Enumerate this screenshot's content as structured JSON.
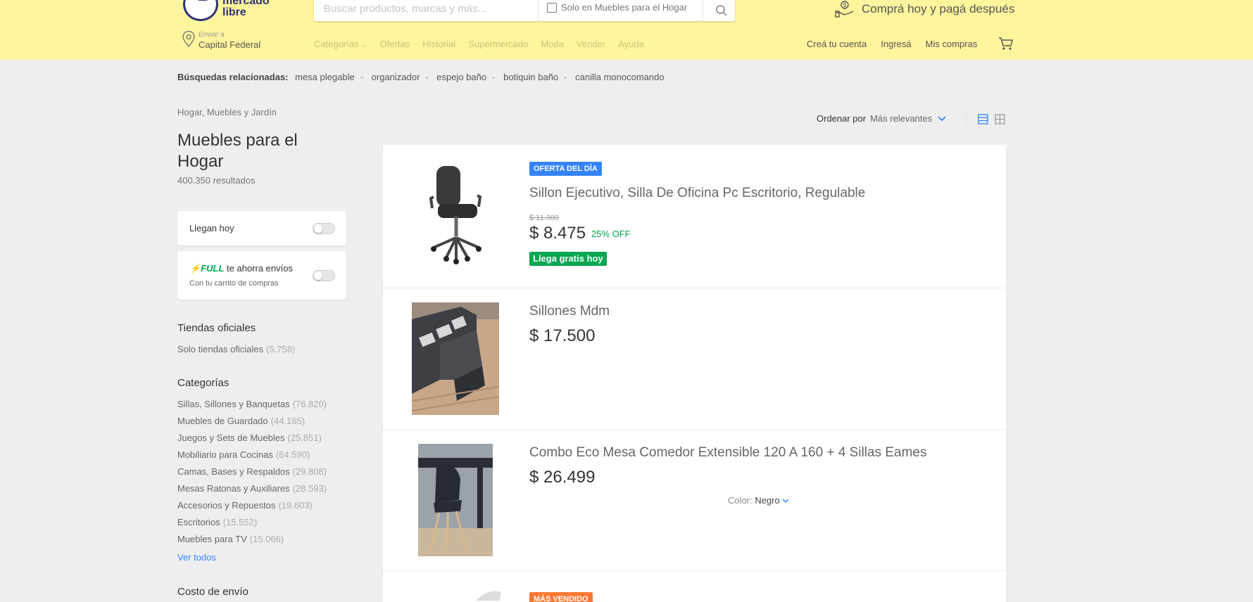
{
  "header": {
    "logo_text_line1": "mercado",
    "logo_text_line2": "libre",
    "search_placeholder": "Buscar productos, marcas y más...",
    "search_filter_label": "Solo en Muebles para el Hogar",
    "promo_text": "Comprá hoy y pagá después",
    "location_small": "Enviar a",
    "location_big": "Capital Federal",
    "nav": [
      "Categorías",
      "Ofertas",
      "Historial",
      "Supermercado",
      "Moda",
      "Vender",
      "Ayuda"
    ],
    "user_nav": [
      "Creá tu cuenta",
      "Ingresá",
      "Mis compras"
    ]
  },
  "related": {
    "label": "Búsquedas relacionadas:",
    "items": [
      "mesa plegable",
      "organizador",
      "espejo baño",
      "botiquin baño",
      "canilla monocomando"
    ]
  },
  "sidebar": {
    "breadcrumb": "Hogar, Muebles y Jardín",
    "title": "Muebles para el Hogar",
    "results": "400.350 resultados",
    "filter_today": "Llegan hoy",
    "full_badge": "FULL",
    "full_label": "te ahorra envíos",
    "full_sub": "Con tu carrito de compras",
    "official_title": "Tiendas oficiales",
    "official_link": "Solo tiendas oficiales",
    "official_count": "(5.758)",
    "categories_title": "Categorías",
    "categories": [
      {
        "label": "Sillas, Sillones y Banquetas",
        "count": "(76.820)"
      },
      {
        "label": "Muebles de Guardado",
        "count": "(44.165)"
      },
      {
        "label": "Juegos y Sets de Muebles",
        "count": "(25.851)"
      },
      {
        "label": "Mobiliario para Cocinas",
        "count": "(64.590)"
      },
      {
        "label": "Camas, Bases y Respaldos",
        "count": "(29.808)"
      },
      {
        "label": "Mesas Ratonas y Auxiliares",
        "count": "(28.593)"
      },
      {
        "label": "Accesorios y Repuestos",
        "count": "(19.603)"
      },
      {
        "label": "Escritorios",
        "count": "(15.552)"
      },
      {
        "label": "Muebles para TV",
        "count": "(15.066)"
      }
    ],
    "ver_todos": "Ver todos",
    "shipping_title": "Costo de envío"
  },
  "sort": {
    "label": "Ordenar por",
    "value": "Más relevantes"
  },
  "items": [
    {
      "badge": "OFERTA DEL DÍA",
      "title": "Sillon Ejecutivo, Silla De Oficina Pc Escritorio, Regulable",
      "old_price": "$ 11.300",
      "price": "$ 8.475",
      "discount": "25% OFF",
      "shipping": "Llega gratis hoy"
    },
    {
      "title": "Sillones Mdm",
      "price": "$ 17.500"
    },
    {
      "title": "Combo Eco Mesa Comedor Extensible 120 A 160 + 4 Sillas Eames",
      "price": "$ 26.499",
      "color_label": "Color:",
      "color_value": "Negro"
    },
    {
      "badge": "MÁS VENDIDO"
    }
  ],
  "colors": {
    "header_bg": "#fff59d",
    "accent_blue": "#3483fa",
    "green": "#00a650",
    "orange": "#ff7733"
  }
}
